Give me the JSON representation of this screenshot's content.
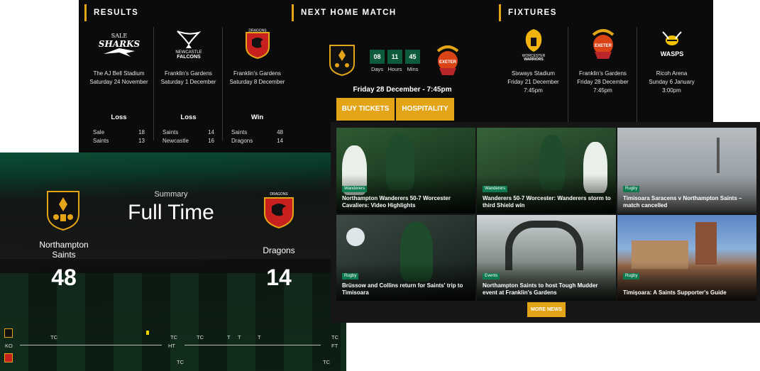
{
  "results": {
    "heading": "RESULTS",
    "items": [
      {
        "logo_text": "SALE SHARKS",
        "venue": "The AJ Bell Stadium",
        "date": "Saturday 24 November",
        "outcome": "Loss",
        "home": {
          "team": "Sale",
          "score": "18"
        },
        "away": {
          "team": "Saints",
          "score": "13"
        }
      },
      {
        "logo_text": "NEWCASTLE FALCONS",
        "venue": "Franklin's Gardens",
        "date": "Saturday 1 December",
        "outcome": "Loss",
        "home": {
          "team": "Saints",
          "score": "14"
        },
        "away": {
          "team": "Newcastle",
          "score": "16"
        }
      },
      {
        "logo_text": "DRAGONS",
        "venue": "Franklin's Gardens",
        "date": "Saturday 8 December",
        "outcome": "Win",
        "home": {
          "team": "Saints",
          "score": "48"
        },
        "away": {
          "team": "Dragons",
          "score": "14"
        }
      }
    ]
  },
  "next_match": {
    "heading": "NEXT HOME MATCH",
    "countdown": [
      {
        "value": "08",
        "label": "Days"
      },
      {
        "value": "11",
        "label": "Hours"
      },
      {
        "value": "45",
        "label": "Mins"
      }
    ],
    "opponent_logo_text": "EXETER RUGBY",
    "datetime": "Friday 28 December - 7:45pm",
    "buy_tickets": "BUY TICKETS",
    "hospitality": "HOSPITALITY"
  },
  "fixtures": {
    "heading": "FIXTURES",
    "items": [
      {
        "logo_text": "WORCESTER WARRIORS",
        "venue": "Sixways Stadium",
        "date": "Friday 21 December",
        "time": "7:45pm"
      },
      {
        "logo_text": "EXETER RUGBY",
        "venue": "Franklin's Gardens",
        "date": "Friday 28 December",
        "time": "7:45pm"
      },
      {
        "logo_text": "WASPS",
        "venue": "Ricoh Arena",
        "date": "Sunday 6 January",
        "time": "3:00pm"
      }
    ]
  },
  "scoreboard": {
    "summary_label": "Summary",
    "status": "Full Time",
    "home_team": "Northampton Saints",
    "home_score": "48",
    "away_team": "Dragons",
    "away_score": "14",
    "away_crest_text": "DRAGONS",
    "timeline": {
      "ko": "KO",
      "ht": "HT",
      "ft": "FT",
      "tc": "TC",
      "t": "T"
    }
  },
  "news": {
    "more_label": "MORE NEWS",
    "items": [
      {
        "tag": "Wanderers",
        "title": "Northampton Wanderers 50-7 Worcester Cavaliers: Video Highlights"
      },
      {
        "tag": "Wanderers",
        "title": "Wanderers 50-7 Worcester: Wanderers storm to third Shield win"
      },
      {
        "tag": "Rugby",
        "title": "Timisoara Saracens v Northampton Saints – match cancelled"
      },
      {
        "tag": "Rugby",
        "title": "Brüssow and Collins return for Saints' trip to Timisoara"
      },
      {
        "tag": "Events",
        "title": "Northampton Saints to host Tough Mudder event at Franklin's Gardens"
      },
      {
        "tag": "Rugby",
        "title": "Timișoara: A Saints Supporter's Guide"
      }
    ]
  },
  "colors": {
    "accent_gold": "#e3a418",
    "saints_green": "#0e5a3c",
    "panel_black": "#0b0b0b"
  }
}
